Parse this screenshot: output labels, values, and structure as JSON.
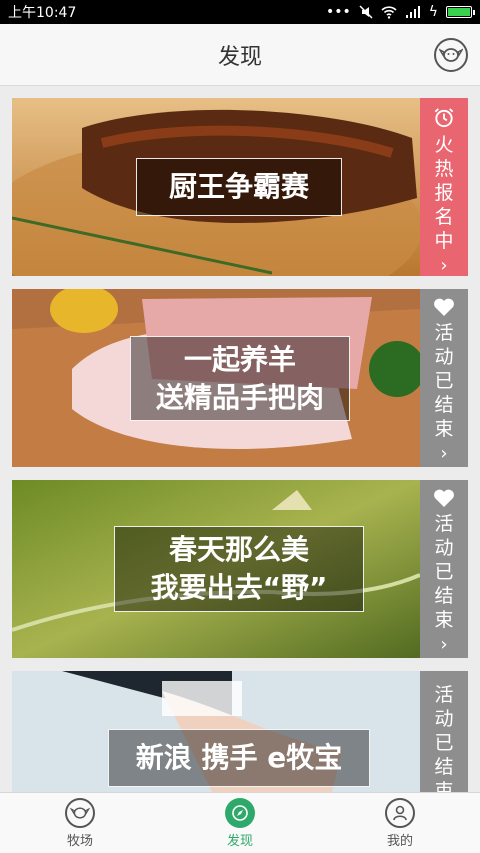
{
  "status_bar": {
    "time": "上午10:47"
  },
  "header": {
    "title": "发现"
  },
  "cards": [
    {
      "lines": [
        "厨王争霸赛"
      ],
      "status": "火热报名中",
      "status_type": "hot"
    },
    {
      "lines": [
        "一起养羊",
        "送精品手把肉"
      ],
      "status": "活动已结束",
      "status_type": "ended"
    },
    {
      "lines": [
        "春天那么美",
        "我要出去“野”"
      ],
      "status": "活动已结束",
      "status_type": "ended"
    },
    {
      "lines": [
        "新浪 携手 e牧宝"
      ],
      "status": "活动已结束",
      "status_type": "ended"
    }
  ],
  "bottom_nav": [
    {
      "label": "牧场",
      "icon": "sheep-icon"
    },
    {
      "label": "发现",
      "icon": "compass-icon",
      "active": true
    },
    {
      "label": "我的",
      "icon": "user-icon"
    }
  ],
  "colors": {
    "accent": "#2fa96b",
    "hot": "#e96570",
    "ended": "#8e8e8e"
  }
}
